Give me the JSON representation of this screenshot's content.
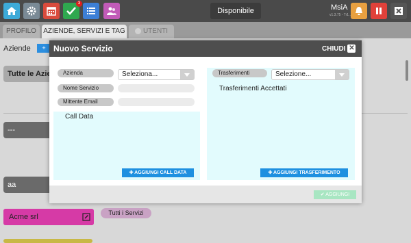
{
  "topbar": {
    "status_label": "Disponibile",
    "user_name": "MsiA",
    "user_version": "v1.3.75 - Tr1...",
    "notification_count": "3",
    "colors": {
      "home": "#3daad8",
      "settings": "#7a8a96",
      "calendar": "#d94b3c",
      "check": "#2fa84f",
      "list": "#3d7fd6",
      "users": "#c25bb8",
      "alarm": "#e8a040",
      "pause": "#e0413a",
      "close": "#555555"
    }
  },
  "tabs": [
    "PROFILO",
    "AZIENDE, SERVIZI E TAG",
    "UTENTI"
  ],
  "background": {
    "heading": "Aziende",
    "row1": "Tutte le Azie",
    "row2": "---",
    "row3": "aa",
    "acme": "Acme srl",
    "tag": "Tutti i Servizi"
  },
  "modal": {
    "title": "Nuovo Servizio",
    "close_label": "CHIUDI",
    "left": {
      "azienda_label": "Azienda",
      "azienda_value": "Seleziona...",
      "nome_label": "Nome Servizio",
      "mittente_label": "Mittente Email",
      "call_data_title": "Call Data",
      "add_call_data": "AGGIUNGI CALL DATA"
    },
    "right": {
      "trasferimenti_label": "Trasferimenti",
      "trasferimenti_value": "Selezione...",
      "accettati_title": "Trasferimenti Accettati",
      "add_trasferimento": "AGGIUNGI TRASFERIMENTO"
    },
    "submit_label": "AGGIUNGI"
  }
}
